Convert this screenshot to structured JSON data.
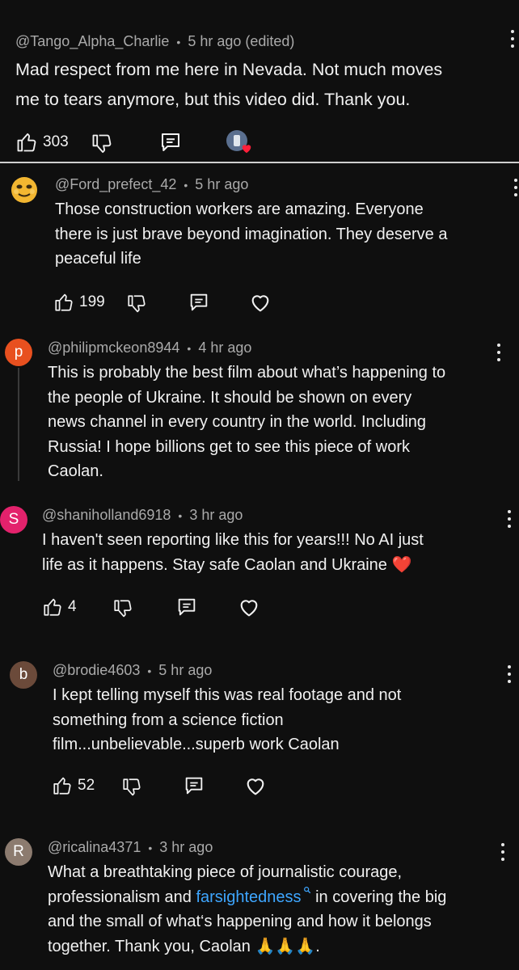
{
  "colors": {
    "background": "#0f0f0f",
    "text": "#f1f1f1",
    "meta": "#aaaaaa",
    "link": "#3ea6ff",
    "avatar_p": "#e8501f",
    "avatar_s": "#e3226c",
    "avatar_b": "#6b4a3a",
    "avatar_r": "#8c7b6f"
  },
  "comments": [
    {
      "author": "@Tango_Alpha_Charlie",
      "time": "5 hr ago (edited)",
      "lines": [
        "Mad respect from me here in Nevada. Not much moves",
        "me to tears anymore, but this video did. Thank you."
      ],
      "likes": "303",
      "creator_heart": true
    },
    {
      "author": "@Ford_prefect_42",
      "time": "5 hr ago",
      "lines": [
        "Those construction workers are amazing. Everyone",
        "there is just brave beyond imagination. They deserve a",
        "peaceful life"
      ],
      "likes": "199",
      "avatar_icon": "emoji-face-icon"
    },
    {
      "author": "@philipmckeon8944",
      "time": "4 hr ago",
      "avatar_letter": "p",
      "lines": [
        "This is probably the best film about what’s happening to",
        "the people of Ukraine. It should be shown on every",
        "news channel in every country in the world. Including",
        "Russia! I hope billions get to see this piece of work",
        "Caolan."
      ]
    },
    {
      "author": "@shaniholland6918",
      "time": "3 hr ago",
      "avatar_letter": "S",
      "lines": [
        "I haven't seen reporting like this for years!!! No AI just",
        "life as it happens. Stay safe Caolan and Ukraine"
      ],
      "emoji": "❤️",
      "likes": "4"
    },
    {
      "author": "@brodie4603",
      "time": "5 hr ago",
      "avatar_letter": "b",
      "lines": [
        "I kept telling myself this was real footage and not",
        "something from a science fiction",
        "film...unbelievable...superb work Caolan"
      ],
      "likes": "52"
    },
    {
      "author": "@ricalina4371",
      "time": "3 hr ago",
      "avatar_letter": "R",
      "line1": "What a breathtaking piece of journalistic courage,",
      "line2_pre": "professionalism and",
      "line2_link": "farsightedness",
      "line2_post": "in covering the big",
      "line3": "and the small of what‘s happening and how it belongs",
      "line4": "together. Thank you, Caolan",
      "line4_emoji": "🙏🙏🙏",
      "line4_end": "."
    }
  ],
  "separator": "•"
}
